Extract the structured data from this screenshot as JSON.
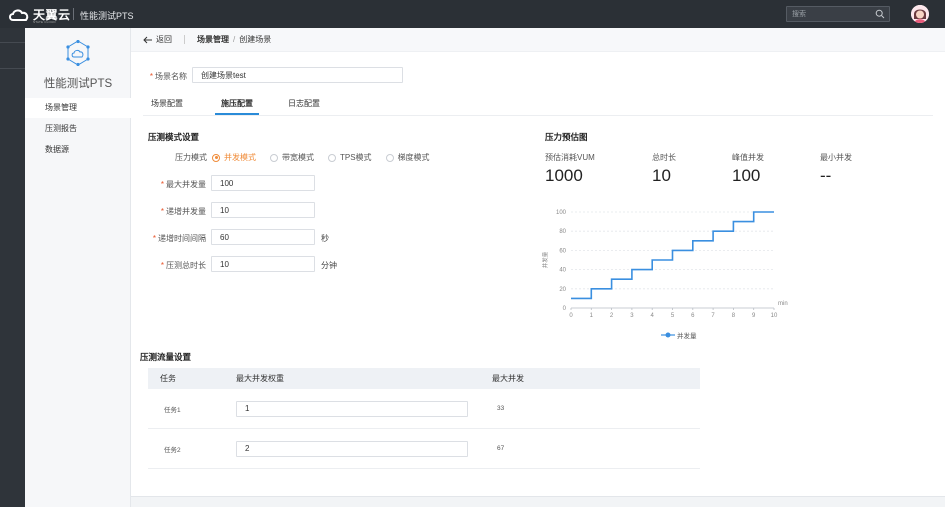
{
  "topbar": {
    "brand": "天翼云",
    "brand_sub": "STATE CLOUD",
    "app_title": "性能测试PTS",
    "search_placeholder": "搜索"
  },
  "sidenav": {
    "product_name": "性能测试PTS",
    "items": [
      {
        "label": "场景管理",
        "active": true
      },
      {
        "label": "压测报告",
        "active": false
      },
      {
        "label": "数据源",
        "active": false
      }
    ]
  },
  "breadcrumb": {
    "back_label": "返回",
    "parent": "场景管理",
    "current": "创建场景"
  },
  "scene": {
    "name_label": "场景名称",
    "name_value": "创建场景test"
  },
  "tabs": [
    {
      "label": "场景配置",
      "active": false
    },
    {
      "label": "施压配置",
      "active": true
    },
    {
      "label": "日志配置",
      "active": false
    }
  ],
  "pressure_mode": {
    "section_title": "压测模式设置",
    "mode_label": "压力模式",
    "options": [
      {
        "label": "并发模式",
        "checked": true
      },
      {
        "label": "带宽模式",
        "checked": false
      },
      {
        "label": "TPS模式",
        "checked": false
      },
      {
        "label": "梯度模式",
        "checked": false
      }
    ],
    "fields": [
      {
        "label": "最大并发量",
        "value": "100",
        "unit": ""
      },
      {
        "label": "递增并发量",
        "value": "10",
        "unit": ""
      },
      {
        "label": "递增时间间隔",
        "value": "60",
        "unit": "秒"
      },
      {
        "label": "压测总时长",
        "value": "10",
        "unit": "分钟"
      }
    ]
  },
  "estimate": {
    "section_title": "压力预估图",
    "stats": [
      {
        "label": "预估消耗VUM",
        "value": "1000"
      },
      {
        "label": "总时长",
        "value": "10"
      },
      {
        "label": "峰值并发",
        "value": "100"
      },
      {
        "label": "最小并发",
        "value": "--"
      }
    ]
  },
  "chart_data": {
    "type": "line",
    "step": true,
    "title": "",
    "xlabel": "min",
    "ylabel": "并发量",
    "x": [
      0,
      1,
      2,
      3,
      4,
      5,
      6,
      7,
      8,
      9,
      10
    ],
    "x_ticks": [
      "0",
      "1",
      "2",
      "3",
      "4",
      "5",
      "6",
      "7",
      "8",
      "9",
      "10"
    ],
    "y_ticks": [
      "0",
      "20",
      "40",
      "60",
      "80",
      "100"
    ],
    "xlim": [
      0,
      10
    ],
    "ylim": [
      0,
      100
    ],
    "grid": true,
    "legend": "bottom",
    "series": [
      {
        "name": "并发量",
        "color": "#3a8fe0",
        "values": [
          10,
          20,
          30,
          40,
          50,
          60,
          70,
          80,
          90,
          100,
          100
        ]
      }
    ]
  },
  "traffic": {
    "section_title": "压测流量设置",
    "columns": [
      "任务",
      "最大并发权重",
      "最大并发"
    ],
    "rows": [
      {
        "task": "任务1",
        "weight": "1",
        "max": "33"
      },
      {
        "task": "任务2",
        "weight": "2",
        "max": "67"
      }
    ]
  }
}
